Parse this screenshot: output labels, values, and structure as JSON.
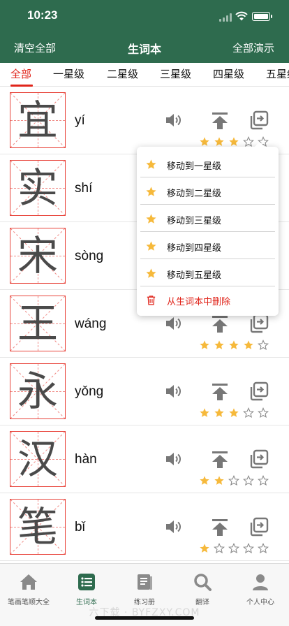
{
  "status_bar": {
    "time": "10:23"
  },
  "nav": {
    "left": "清空全部",
    "title": "生词本",
    "right": "全部演示"
  },
  "tabs": [
    {
      "label": "全部",
      "active": true
    },
    {
      "label": "一星级",
      "active": false
    },
    {
      "label": "二星级",
      "active": false
    },
    {
      "label": "三星级",
      "active": false
    },
    {
      "label": "四星级",
      "active": false
    },
    {
      "label": "五星级",
      "active": false
    }
  ],
  "words": [
    {
      "char": "宜",
      "pinyin": "yí",
      "stars": 3
    },
    {
      "char": "实",
      "pinyin": "shí",
      "stars": 0
    },
    {
      "char": "宋",
      "pinyin": "sòng",
      "stars": 0
    },
    {
      "char": "王",
      "pinyin": "wáng",
      "stars": 4
    },
    {
      "char": "永",
      "pinyin": "yǒng",
      "stars": 3
    },
    {
      "char": "汉",
      "pinyin": "hàn",
      "stars": 2
    },
    {
      "char": "笔",
      "pinyin": "bǐ",
      "stars": 1
    }
  ],
  "popup_menu": [
    {
      "label": "移动到一星级",
      "icon": "star-icon"
    },
    {
      "label": "移动到二星级",
      "icon": "star-icon"
    },
    {
      "label": "移动到三星级",
      "icon": "star-icon"
    },
    {
      "label": "移动到四星级",
      "icon": "star-icon"
    },
    {
      "label": "移动到五星级",
      "icon": "star-icon"
    },
    {
      "label": "从生词本中删除",
      "icon": "trash-icon",
      "danger": true
    }
  ],
  "bottom_tabs": [
    {
      "label": "笔画笔顺大全",
      "icon": "home-icon",
      "active": false
    },
    {
      "label": "生词本",
      "icon": "list-icon",
      "active": true
    },
    {
      "label": "练习册",
      "icon": "book-icon",
      "active": false
    },
    {
      "label": "翻译",
      "icon": "search-icon",
      "active": false
    },
    {
      "label": "个人中心",
      "icon": "person-icon",
      "active": false
    }
  ],
  "watermark": "六下载 · BYFZXY.COM",
  "colors": {
    "header_bg": "#2e6b4e",
    "accent_red": "#e0251b",
    "star_filled": "#f6b93b",
    "icon_gray": "#777777",
    "grid_red": "#e8433a"
  }
}
